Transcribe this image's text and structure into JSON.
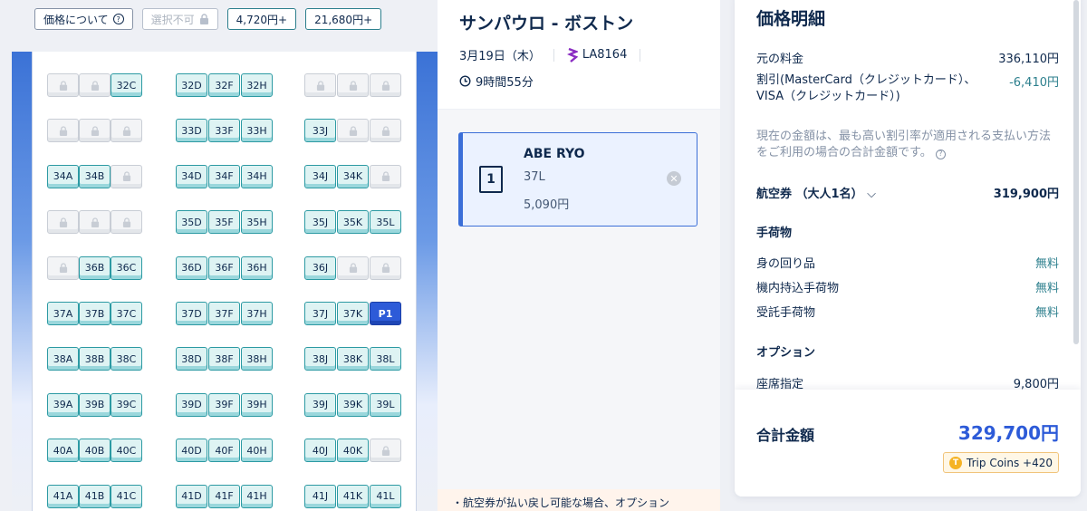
{
  "legend": {
    "about_price": "価格について",
    "unavailable": "選択不可",
    "price_low": "4,720円+",
    "price_high": "21,680円+"
  },
  "seatmap": {
    "rows": [
      {
        "row": "32",
        "seats": [
          {
            "id": "32A",
            "label": "",
            "status": "taken"
          },
          {
            "id": "32B",
            "label": "",
            "status": "taken"
          },
          {
            "id": "32C",
            "label": "32C",
            "status": "avail"
          },
          {
            "id": "32D",
            "label": "32D",
            "status": "avail"
          },
          {
            "id": "32F",
            "label": "32F",
            "status": "avail"
          },
          {
            "id": "32H",
            "label": "32H",
            "status": "avail"
          },
          {
            "id": "32J",
            "label": "",
            "status": "taken"
          },
          {
            "id": "32K",
            "label": "",
            "status": "taken"
          },
          {
            "id": "32L",
            "label": "",
            "status": "taken"
          }
        ]
      },
      {
        "row": "33",
        "seats": [
          {
            "id": "33A",
            "label": "",
            "status": "taken"
          },
          {
            "id": "33B",
            "label": "",
            "status": "taken"
          },
          {
            "id": "33C",
            "label": "",
            "status": "taken"
          },
          {
            "id": "33D",
            "label": "33D",
            "status": "avail"
          },
          {
            "id": "33F",
            "label": "33F",
            "status": "avail"
          },
          {
            "id": "33H",
            "label": "33H",
            "status": "avail"
          },
          {
            "id": "33J",
            "label": "33J",
            "status": "avail"
          },
          {
            "id": "33K",
            "label": "",
            "status": "taken"
          },
          {
            "id": "33L",
            "label": "",
            "status": "taken"
          }
        ]
      },
      {
        "row": "34",
        "seats": [
          {
            "id": "34A",
            "label": "34A",
            "status": "avail"
          },
          {
            "id": "34B",
            "label": "34B",
            "status": "avail"
          },
          {
            "id": "34C",
            "label": "",
            "status": "taken"
          },
          {
            "id": "34D",
            "label": "34D",
            "status": "avail"
          },
          {
            "id": "34F",
            "label": "34F",
            "status": "avail"
          },
          {
            "id": "34H",
            "label": "34H",
            "status": "avail"
          },
          {
            "id": "34J",
            "label": "34J",
            "status": "avail"
          },
          {
            "id": "34K",
            "label": "34K",
            "status": "avail"
          },
          {
            "id": "34L",
            "label": "",
            "status": "taken"
          }
        ]
      },
      {
        "row": "35",
        "seats": [
          {
            "id": "35A",
            "label": "",
            "status": "taken"
          },
          {
            "id": "35B",
            "label": "",
            "status": "taken"
          },
          {
            "id": "35C",
            "label": "",
            "status": "taken"
          },
          {
            "id": "35D",
            "label": "35D",
            "status": "avail"
          },
          {
            "id": "35F",
            "label": "35F",
            "status": "avail"
          },
          {
            "id": "35H",
            "label": "35H",
            "status": "avail"
          },
          {
            "id": "35J",
            "label": "35J",
            "status": "avail"
          },
          {
            "id": "35K",
            "label": "35K",
            "status": "avail"
          },
          {
            "id": "35L",
            "label": "35L",
            "status": "avail"
          }
        ]
      },
      {
        "row": "36",
        "seats": [
          {
            "id": "36A",
            "label": "",
            "status": "taken"
          },
          {
            "id": "36B",
            "label": "36B",
            "status": "avail"
          },
          {
            "id": "36C",
            "label": "36C",
            "status": "avail"
          },
          {
            "id": "36D",
            "label": "36D",
            "status": "avail"
          },
          {
            "id": "36F",
            "label": "36F",
            "status": "avail"
          },
          {
            "id": "36H",
            "label": "36H",
            "status": "avail"
          },
          {
            "id": "36J",
            "label": "36J",
            "status": "avail"
          },
          {
            "id": "36K",
            "label": "",
            "status": "taken"
          },
          {
            "id": "36L",
            "label": "",
            "status": "taken"
          }
        ]
      },
      {
        "row": "37",
        "seats": [
          {
            "id": "37A",
            "label": "37A",
            "status": "avail"
          },
          {
            "id": "37B",
            "label": "37B",
            "status": "avail"
          },
          {
            "id": "37C",
            "label": "37C",
            "status": "avail"
          },
          {
            "id": "37D",
            "label": "37D",
            "status": "avail"
          },
          {
            "id": "37F",
            "label": "37F",
            "status": "avail"
          },
          {
            "id": "37H",
            "label": "37H",
            "status": "avail"
          },
          {
            "id": "37J",
            "label": "37J",
            "status": "avail"
          },
          {
            "id": "37K",
            "label": "37K",
            "status": "avail"
          },
          {
            "id": "37L",
            "label": "P1",
            "status": "selected"
          }
        ]
      },
      {
        "row": "38",
        "seats": [
          {
            "id": "38A",
            "label": "38A",
            "status": "avail"
          },
          {
            "id": "38B",
            "label": "38B",
            "status": "avail"
          },
          {
            "id": "38C",
            "label": "38C",
            "status": "avail"
          },
          {
            "id": "38D",
            "label": "38D",
            "status": "avail"
          },
          {
            "id": "38F",
            "label": "38F",
            "status": "avail"
          },
          {
            "id": "38H",
            "label": "38H",
            "status": "avail"
          },
          {
            "id": "38J",
            "label": "38J",
            "status": "avail"
          },
          {
            "id": "38K",
            "label": "38K",
            "status": "avail"
          },
          {
            "id": "38L",
            "label": "38L",
            "status": "avail"
          }
        ]
      },
      {
        "row": "39",
        "seats": [
          {
            "id": "39A",
            "label": "39A",
            "status": "avail"
          },
          {
            "id": "39B",
            "label": "39B",
            "status": "avail"
          },
          {
            "id": "39C",
            "label": "39C",
            "status": "avail"
          },
          {
            "id": "39D",
            "label": "39D",
            "status": "avail"
          },
          {
            "id": "39F",
            "label": "39F",
            "status": "avail"
          },
          {
            "id": "39H",
            "label": "39H",
            "status": "avail"
          },
          {
            "id": "39J",
            "label": "39J",
            "status": "avail"
          },
          {
            "id": "39K",
            "label": "39K",
            "status": "avail"
          },
          {
            "id": "39L",
            "label": "39L",
            "status": "avail"
          }
        ]
      },
      {
        "row": "40",
        "seats": [
          {
            "id": "40A",
            "label": "40A",
            "status": "avail"
          },
          {
            "id": "40B",
            "label": "40B",
            "status": "avail"
          },
          {
            "id": "40C",
            "label": "40C",
            "status": "avail"
          },
          {
            "id": "40D",
            "label": "40D",
            "status": "avail"
          },
          {
            "id": "40F",
            "label": "40F",
            "status": "avail"
          },
          {
            "id": "40H",
            "label": "40H",
            "status": "avail"
          },
          {
            "id": "40J",
            "label": "40J",
            "status": "avail"
          },
          {
            "id": "40K",
            "label": "40K",
            "status": "avail"
          },
          {
            "id": "40L",
            "label": "",
            "status": "taken"
          }
        ]
      },
      {
        "row": "41",
        "seats": [
          {
            "id": "41A",
            "label": "41A",
            "status": "avail"
          },
          {
            "id": "41B",
            "label": "41B",
            "status": "avail"
          },
          {
            "id": "41C",
            "label": "41C",
            "status": "avail"
          },
          {
            "id": "41D",
            "label": "41D",
            "status": "avail"
          },
          {
            "id": "41F",
            "label": "41F",
            "status": "avail"
          },
          {
            "id": "41H",
            "label": "41H",
            "status": "avail"
          },
          {
            "id": "41J",
            "label": "41J",
            "status": "avail"
          },
          {
            "id": "41K",
            "label": "41K",
            "status": "avail"
          },
          {
            "id": "41L",
            "label": "41L",
            "status": "avail"
          }
        ]
      }
    ]
  },
  "flight": {
    "route": "サンパウロ - ボストン",
    "date": "3月19日（木）",
    "flight_no": "LA8164",
    "duration": "9時間55分"
  },
  "passenger": {
    "index": "1",
    "name": "ABE RYO",
    "seat": "37L",
    "price": "5,090円"
  },
  "notice": "・航空券が払い戻し可能な場合、オプション",
  "price": {
    "title": "価格明細",
    "base_label": "元の料金",
    "base_value": "336,110円",
    "discount_label": "割引(MasterCard（クレジットカード）、VISA（クレジットカード）)",
    "discount_value": "-6,410円",
    "note": "現在の金額は、最も高い割引率が適用される支払い方法をご利用の場合の合計金額です。",
    "ticket_label": "航空券 （大人1名）",
    "ticket_value": "319,900円",
    "baggage_header": "手荷物",
    "baggage": [
      {
        "label": "身の回り品",
        "value": "無料"
      },
      {
        "label": "機内持込手荷物",
        "value": "無料"
      },
      {
        "label": "受託手荷物",
        "value": "無料"
      }
    ],
    "option_header": "オプション",
    "seat_label": "座席指定",
    "seat_value": "9,800円",
    "total_label": "合計金額",
    "total_value": "329,700円",
    "coins": "Trip Coins +420"
  },
  "colors": {
    "accent": "#2d5bd8",
    "seat_available": "#2c9aa3",
    "discount": "#2c7f8d"
  }
}
